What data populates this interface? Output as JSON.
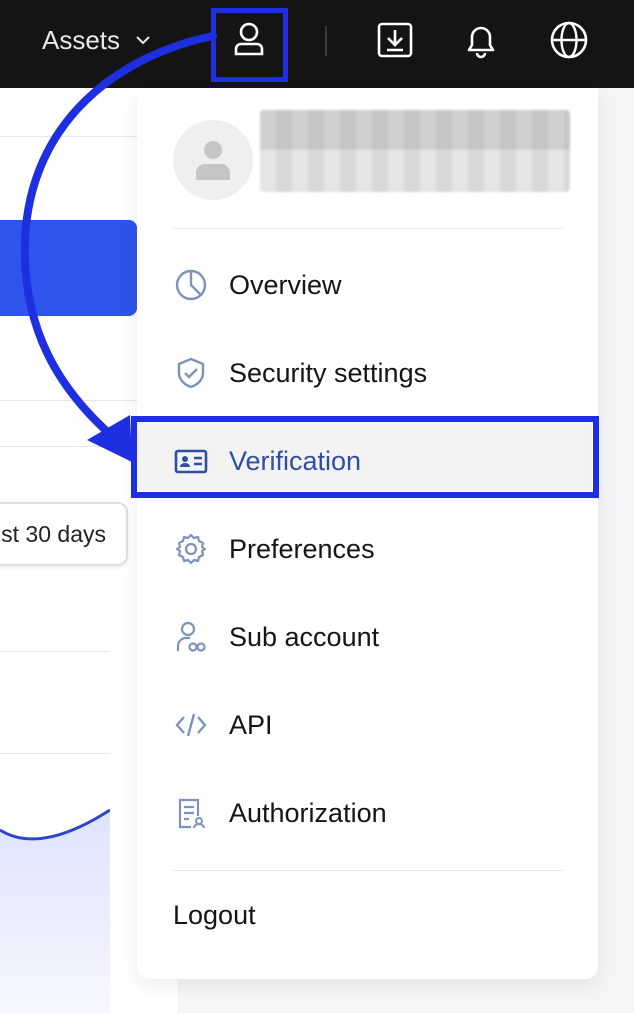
{
  "topbar": {
    "assets_label": "Assets",
    "icons": [
      "user-icon",
      "download-icon",
      "bell-icon",
      "globe-icon"
    ]
  },
  "background_page": {
    "range_button_label": "st 30 days"
  },
  "profile_menu": {
    "username": "(blurred)",
    "items": [
      {
        "label": "Overview",
        "icon": "pie-chart-icon"
      },
      {
        "label": "Security settings",
        "icon": "shield-check-icon"
      },
      {
        "label": "Verification",
        "icon": "id-card-icon",
        "active": true
      },
      {
        "label": "Preferences",
        "icon": "gear-icon"
      },
      {
        "label": "Sub account",
        "icon": "sub-account-icon"
      },
      {
        "label": "API",
        "icon": "code-icon"
      },
      {
        "label": "Authorization",
        "icon": "authorization-doc-icon"
      }
    ],
    "logout_label": "Logout"
  },
  "colors": {
    "annotation_blue": "#1d2fe0",
    "active_text": "#2f4fa6",
    "icon_blue": "#7d93bd",
    "topbar_bg": "#141414",
    "primary_button": "#2f54eb"
  }
}
